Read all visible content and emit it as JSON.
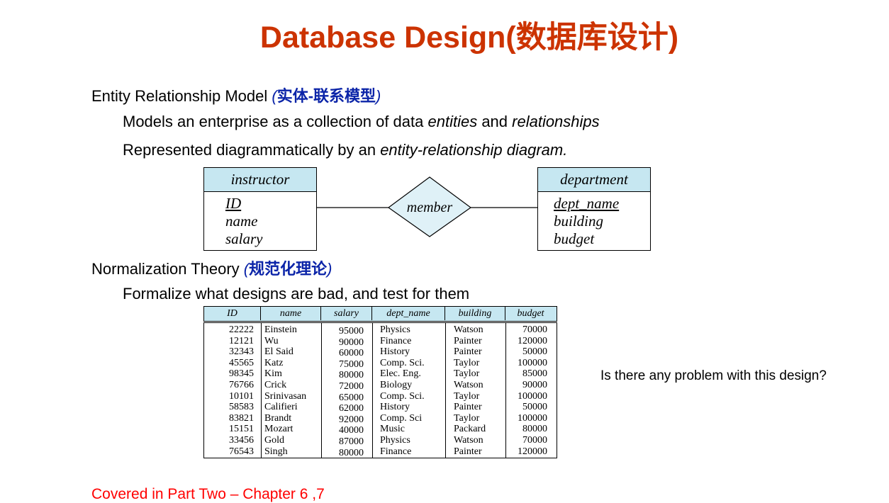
{
  "title": "Database Design(数据库设计)",
  "er": {
    "heading": "Entity Relationship Model ",
    "heading_cn": "实体-联系模型",
    "bullet1_pre": "Models an enterprise as a collection of data ",
    "bullet1_em1": "entities",
    "bullet1_mid": " and ",
    "bullet1_em2": "relationships",
    "bullet2_pre": "Represented diagrammatically by an ",
    "bullet2_em": "entity-relationship diagram."
  },
  "diagram": {
    "entity1": {
      "name": "instructor",
      "key": "ID",
      "attrs": [
        "name",
        "salary"
      ]
    },
    "relationship": "member",
    "entity2": {
      "name": "department",
      "key": "dept_name",
      "attrs": [
        "building",
        "budget"
      ]
    }
  },
  "norm": {
    "heading": "Normalization Theory ",
    "heading_cn": "规范化理论",
    "bullet1": "Formalize what designs are bad, and test for them"
  },
  "table": {
    "headers": [
      "ID",
      "name",
      "salary",
      "dept_name",
      "building",
      "budget"
    ],
    "rows": [
      [
        "22222",
        "Einstein",
        "95000",
        "Physics",
        "Watson",
        "70000"
      ],
      [
        "12121",
        "Wu",
        "90000",
        "Finance",
        "Painter",
        "120000"
      ],
      [
        "32343",
        "El Said",
        "60000",
        "History",
        "Painter",
        "50000"
      ],
      [
        "45565",
        "Katz",
        "75000",
        "Comp. Sci.",
        "Taylor",
        "100000"
      ],
      [
        "98345",
        "Kim",
        "80000",
        "Elec. Eng.",
        "Taylor",
        "85000"
      ],
      [
        "76766",
        "Crick",
        "72000",
        "Biology",
        "Watson",
        "90000"
      ],
      [
        "10101",
        "Srinivasan",
        "65000",
        "Comp. Sci.",
        "Taylor",
        "100000"
      ],
      [
        "58583",
        "Califieri",
        "62000",
        "History",
        "Painter",
        "50000"
      ],
      [
        "83821",
        "Brandt",
        "92000",
        "Comp. Sci",
        "Taylor",
        "100000"
      ],
      [
        "15151",
        "Mozart",
        "40000",
        "Music",
        "Packard",
        "80000"
      ],
      [
        "33456",
        "Gold",
        "87000",
        "Physics",
        "Watson",
        "70000"
      ],
      [
        "76543",
        "Singh",
        "80000",
        "Finance",
        "Painter",
        "120000"
      ]
    ]
  },
  "question": "Is there any problem with this design?",
  "footer": "Covered  in Part Two – Chapter 6 ,7"
}
